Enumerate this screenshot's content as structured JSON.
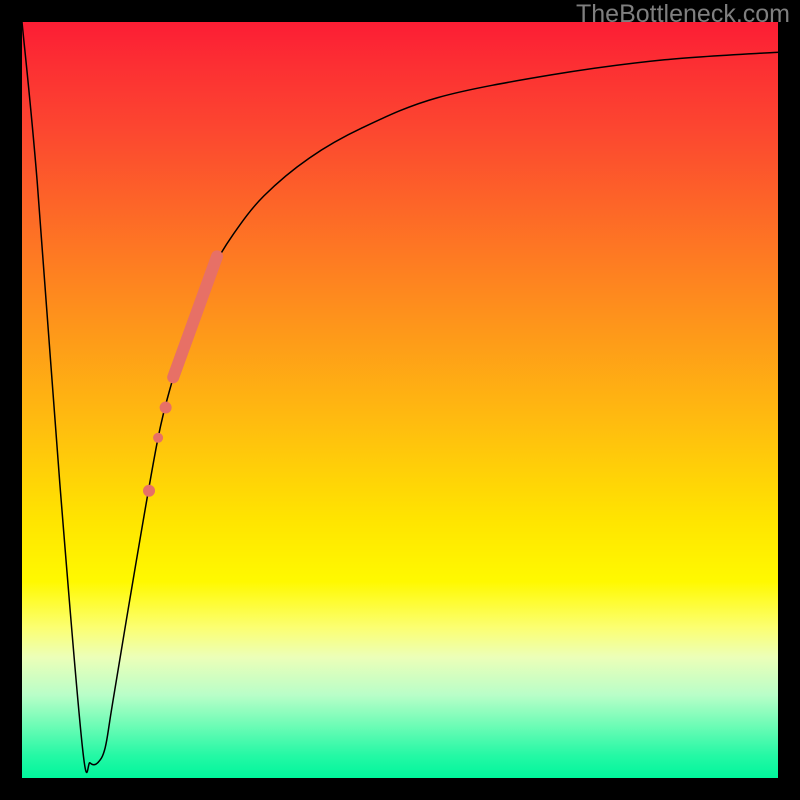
{
  "watermark": "TheBottleneck.com",
  "chart_data": {
    "type": "line",
    "title": "",
    "xlabel": "",
    "ylabel": "",
    "xlim": [
      0,
      100
    ],
    "ylim": [
      0,
      100
    ],
    "background_gradient": {
      "top": "#fc1d34",
      "bottom": "#00f69c",
      "description": "red-yellow-green vertical gradient"
    },
    "series": [
      {
        "name": "bottleneck-curve",
        "color": "#000000",
        "stroke_width": 1.5,
        "x": [
          0,
          2,
          5,
          8,
          9,
          10,
          11,
          12,
          15,
          18,
          20,
          22,
          25,
          28,
          32,
          38,
          45,
          55,
          70,
          85,
          100
        ],
        "y": [
          100,
          79,
          39,
          4,
          2,
          2,
          4,
          10,
          28,
          45,
          53,
          60,
          67,
          72,
          77,
          82,
          86,
          90,
          93,
          95,
          96
        ]
      }
    ],
    "markers": [
      {
        "name": "highlight-segment",
        "color": "#e77066",
        "shape": "rounded-thick-line",
        "stroke_width": 12,
        "x": [
          20.0,
          25.8
        ],
        "y": [
          53.0,
          69.0
        ]
      },
      {
        "name": "highlight-dot-1",
        "color": "#e77066",
        "shape": "circle",
        "radius": 6,
        "x": 19.0,
        "y": 49.0
      },
      {
        "name": "highlight-dot-2",
        "color": "#e77066",
        "shape": "circle",
        "radius": 5,
        "x": 18.0,
        "y": 45.0
      },
      {
        "name": "highlight-dot-3",
        "color": "#e77066",
        "shape": "circle",
        "radius": 6,
        "x": 16.8,
        "y": 38.0
      }
    ]
  }
}
